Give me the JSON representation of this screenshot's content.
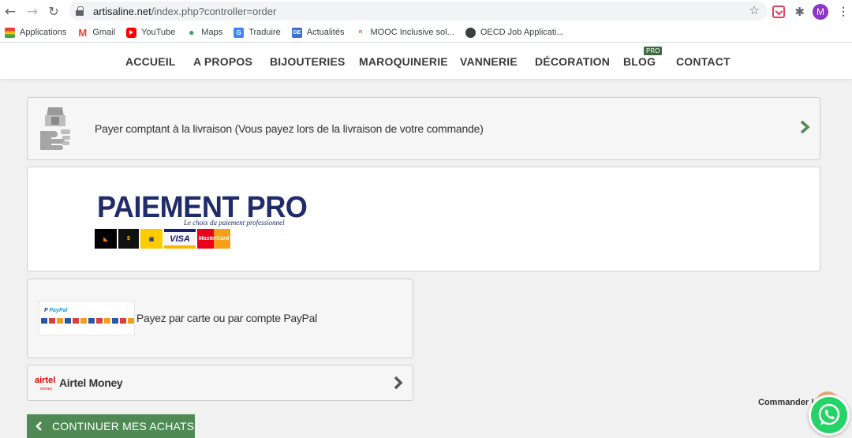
{
  "browser": {
    "url_domain": "artisaline.net",
    "url_path": "/index.php?controller=order",
    "avatar_initial": "M",
    "bookmarks": [
      {
        "label": "Applications",
        "icon": "apps-grid-icon"
      },
      {
        "label": "Gmail",
        "icon": "gmail-icon"
      },
      {
        "label": "YouTube",
        "icon": "youtube-icon"
      },
      {
        "label": "Maps",
        "icon": "maps-pin-icon"
      },
      {
        "label": "Traduire",
        "icon": "translate-icon"
      },
      {
        "label": "Actualités",
        "icon": "news-icon"
      },
      {
        "label": "MOOC Inclusive sol...",
        "icon": "mooc-icon"
      },
      {
        "label": "OECD Job Applicati...",
        "icon": "oecd-globe-icon"
      }
    ]
  },
  "nav": {
    "items": [
      "ACCUEIL",
      "A PROPOS",
      "BIJOUTERIES",
      "MAROQUINERIE",
      "VANNERIE",
      "DÉCORATION",
      "BLOG",
      "CONTACT"
    ],
    "blog_badge": "PRO"
  },
  "payment": {
    "cod_label": "Payer comptant à la livraison (Vous payez lors de la livraison de votre commande)",
    "paiement_pro": {
      "title": "PAIEMENT PRO",
      "slogan": "Le choix du paiement professionnel",
      "cards": [
        "Orange Money",
        "Moov Money",
        "MTN",
        "VISA",
        "MasterCard"
      ]
    },
    "paypal": {
      "logo_a": "Pay",
      "logo_b": "Pal",
      "label": "Payez par carte ou par compte PayPal"
    },
    "airtel": {
      "logo": "airtel",
      "logo_sub": "money",
      "label": "Airtel Money"
    }
  },
  "continue_label": "CONTINUER MES ACHATS",
  "commander_label": "Commander !",
  "colors": {
    "accent_green": "#4f8a55",
    "nav_text": "#3a3a3a",
    "paiement_pro_blue": "#1f2c69",
    "whatsapp_green": "#25d366"
  }
}
